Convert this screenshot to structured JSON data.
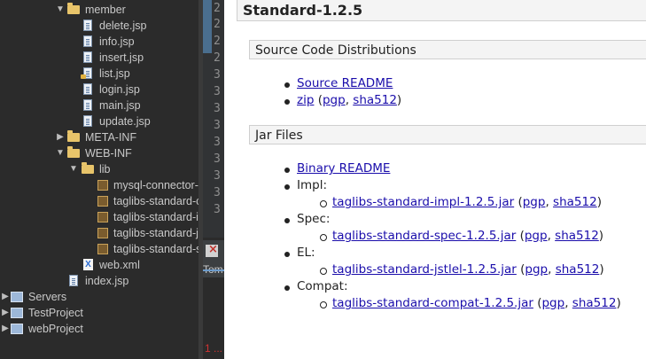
{
  "explorer": {
    "items": [
      {
        "label": "member",
        "kind": "folder-open"
      },
      {
        "label": "delete.jsp",
        "kind": "file"
      },
      {
        "label": "info.jsp",
        "kind": "file"
      },
      {
        "label": "insert.jsp",
        "kind": "file"
      },
      {
        "label": "list.jsp",
        "kind": "file-lock"
      },
      {
        "label": "login.jsp",
        "kind": "file"
      },
      {
        "label": "main.jsp",
        "kind": "file"
      },
      {
        "label": "update.jsp",
        "kind": "file"
      },
      {
        "label": "META-INF",
        "kind": "folder-closed"
      },
      {
        "label": "WEB-INF",
        "kind": "folder-open"
      },
      {
        "label": "lib",
        "kind": "folder-open"
      },
      {
        "label": "mysql-connector-",
        "kind": "jar"
      },
      {
        "label": "taglibs-standard-c",
        "kind": "jar"
      },
      {
        "label": "taglibs-standard-i",
        "kind": "jar"
      },
      {
        "label": "taglibs-standard-j",
        "kind": "jar"
      },
      {
        "label": "taglibs-standard-s",
        "kind": "jar"
      },
      {
        "label": "web.xml",
        "kind": "xml"
      },
      {
        "label": "index.jsp",
        "kind": "file"
      },
      {
        "label": "Servers",
        "kind": "project"
      },
      {
        "label": "TestProject",
        "kind": "project"
      },
      {
        "label": "webProject",
        "kind": "project"
      }
    ]
  },
  "editor": {
    "line_numbers": [
      "2",
      "2",
      "2",
      "2",
      "3",
      "3",
      "3",
      "3",
      "3",
      "3",
      "3",
      "3",
      "3"
    ]
  },
  "console": {
    "tab_label": "Tom",
    "status_text": "1 ..."
  },
  "page": {
    "title": "Standard-1.2.5",
    "source_section": {
      "heading": "Source Code Distributions",
      "readme_link": "Source README",
      "zip_link": "zip",
      "pgp_link": "pgp",
      "sha_link": "sha512"
    },
    "jar_section": {
      "heading": "Jar Files",
      "readme_link": "Binary README",
      "groups": [
        {
          "name": "Impl:",
          "jar": "taglibs-standard-impl-1.2.5.jar",
          "pgp": "pgp",
          "sha": "sha512"
        },
        {
          "name": "Spec:",
          "jar": "taglibs-standard-spec-1.2.5.jar",
          "pgp": "pgp",
          "sha": "sha512"
        },
        {
          "name": "EL:",
          "jar": "taglibs-standard-jstlel-1.2.5.jar",
          "pgp": "pgp",
          "sha": "sha512"
        },
        {
          "name": "Compat:",
          "jar": "taglibs-standard-compat-1.2.5.jar",
          "pgp": "pgp",
          "sha": "sha512"
        }
      ]
    }
  }
}
